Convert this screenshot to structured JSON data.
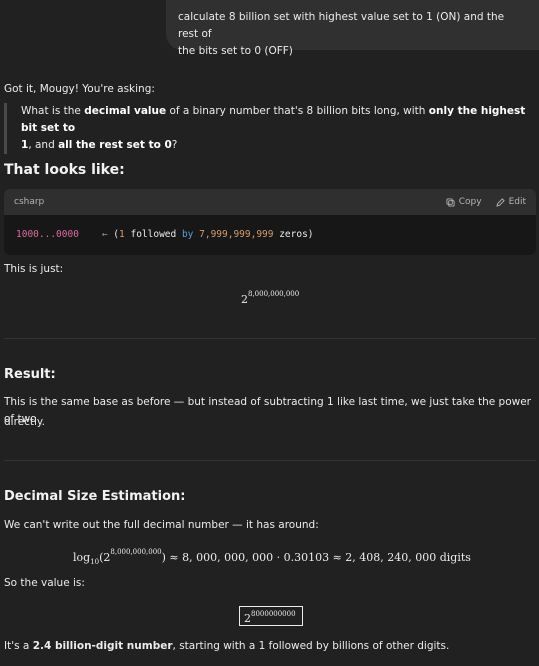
{
  "user_message": {
    "line1": "calculate 8 billion set with highest value set to 1 (ON) and the rest of",
    "line2": "the bits set to 0 (OFF)"
  },
  "reply": {
    "intro": "Got it, Mougy! You're asking:",
    "quote": {
      "p1": "What is the ",
      "b1": "decimal value",
      "p2": " of a binary number that's 8 billion bits long, with ",
      "b2": "only the highest bit set to",
      "b2b": "1",
      "p3": ", and ",
      "b3": "all the rest set to 0",
      "p4": "?"
    },
    "h_looks_like": "That looks like:",
    "code": {
      "language": "csharp",
      "copy_label": "Copy",
      "edit_label": "Edit",
      "bits": "1000...0000",
      "arrow": "←",
      "open": "(",
      "one": "1",
      "followed": " followed ",
      "by": "by",
      "count": " 7,999,999,999",
      "zeros": " zeros)"
    },
    "this_is_just": "This is just:",
    "power_base": "2",
    "power_exp": "8,000,000,000",
    "h_result": "Result:",
    "result_line1": "This is the same base as before — but instead of subtracting 1 like last time, we just take the power of two",
    "result_line2": "directly.",
    "h_decimal": "Decimal Size Estimation:",
    "cant_write": "We can't write out the full decimal number — it has around:",
    "formula": {
      "log": "log",
      "sub": "10",
      "open": "(2",
      "exp": "8,000,000,000",
      "close": ") ≈ 8, 000, 000, 000 · 0.30103 ≈ 2, 408, 240, 000 digits"
    },
    "so_value": "So the value is:",
    "boxed_base": "2",
    "boxed_exp": "8000000000",
    "final": {
      "p1": "It's a ",
      "b1": "2.4 billion-digit number",
      "p2": ", starting with a 1 followed by billions of other digits."
    }
  }
}
